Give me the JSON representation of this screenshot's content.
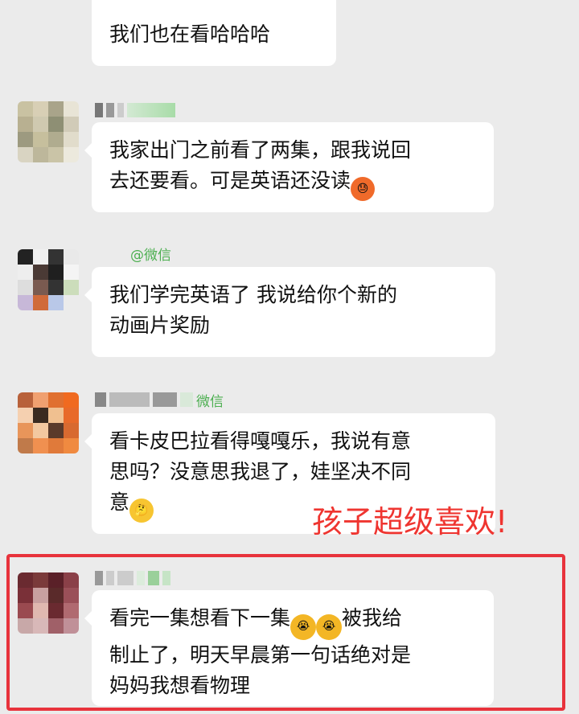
{
  "messages": [
    {
      "text": "我们也在看哈哈哈"
    },
    {
      "text_a": "我家出门之前看了两集，跟我说回\n去还要看。可是英语还没读",
      "emoji": "sweat-face-emoji"
    },
    {
      "sender_suffix": "@微信",
      "text": "我们学完英语了 我说给你个新的\n动画片奖励"
    },
    {
      "sender_suffix": "微信",
      "text_a": "看卡皮巴拉看得嘎嘎乐，我说有意\n思吗？没意思我退了，娃坚决不同\n意",
      "emoji": "thinking-face-emoji"
    },
    {
      "text_a": "看完一集想看下一集",
      "text_b": "被我给\n制止了，明天早晨第一句话绝对是\n妈妈我想看物理",
      "emoji": "crying-laughing-emoji"
    }
  ],
  "annotation": "孩子超级喜欢!",
  "colors": {
    "highlight_border": "#e8333c",
    "annotation": "#ef3530",
    "background": "#ebebeb"
  }
}
